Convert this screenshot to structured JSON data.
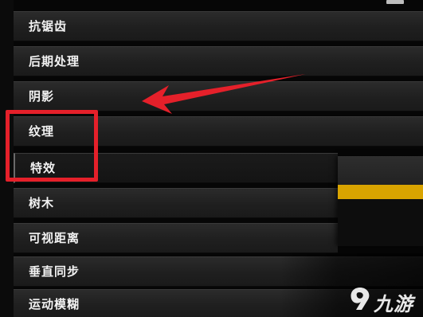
{
  "settings": {
    "items": [
      {
        "label": "抗锯齿"
      },
      {
        "label": "后期处理"
      },
      {
        "label": "阴影"
      },
      {
        "label": "纹理"
      },
      {
        "label": "特效"
      },
      {
        "label": "树木"
      },
      {
        "label": "可视距离"
      },
      {
        "label": "垂直同步"
      },
      {
        "label": "运动模糊"
      }
    ],
    "selected_label": "特效"
  },
  "dropdown": {
    "accent_color": "#d9a400"
  },
  "annotation": {
    "box_color": "#e5202a",
    "arrow_color": "#e5202a",
    "highlighted_items": [
      "纹理",
      "特效"
    ]
  },
  "watermark": {
    "text": "九游",
    "icon": "jiuyou-logo-icon"
  }
}
